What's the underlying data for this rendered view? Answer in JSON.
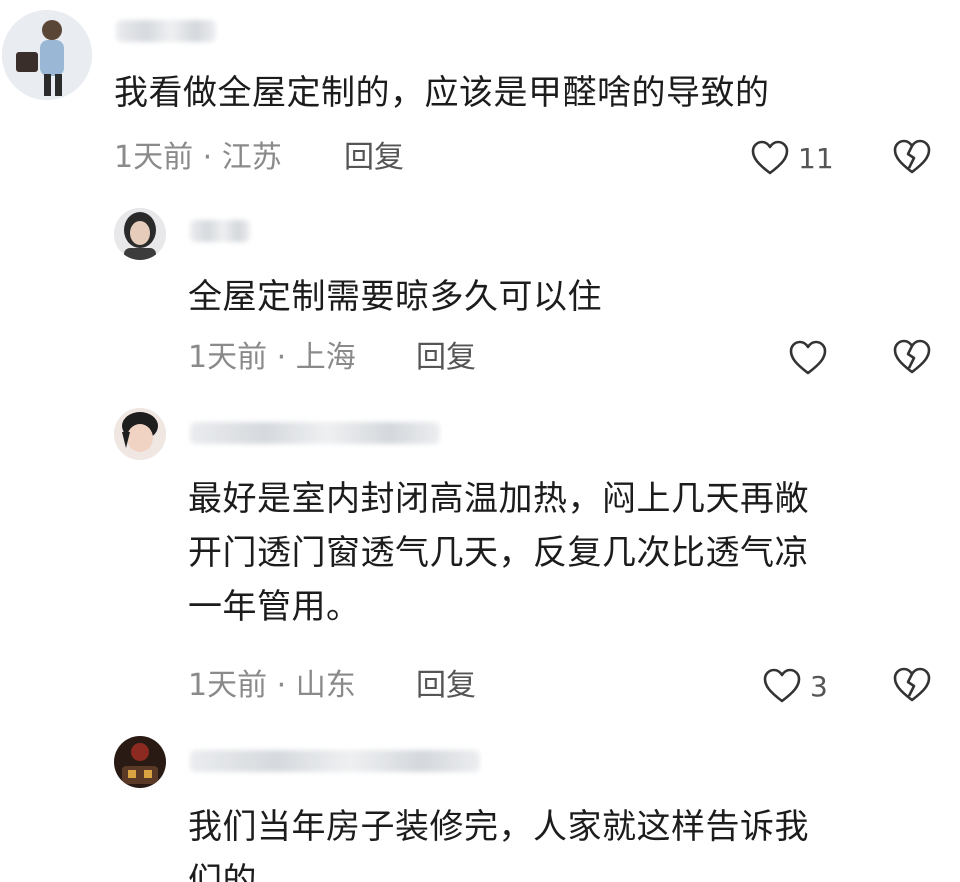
{
  "comments": [
    {
      "text": "我看做全屋定制的，应该是甲醛啥的导致的",
      "time": "1天前",
      "location": "江苏",
      "reply_label": "回复",
      "likes": "11"
    },
    {
      "text": "全屋定制需要晾多久可以住",
      "time": "1天前",
      "location": "上海",
      "reply_label": "回复",
      "likes": ""
    },
    {
      "text": "最好是室内封闭高温加热，闷上几天再敞\n开门透门窗透气几天，反复几次比透气凉\n一年管用。",
      "time": "1天前",
      "location": "山东",
      "reply_label": "回复",
      "likes": "3"
    },
    {
      "text": "我们当年房子装修完，人家就这样告诉我\n们的。",
      "time": "",
      "location": "",
      "reply_label": "",
      "likes": ""
    }
  ],
  "meta_separator": " · ",
  "icons": {
    "like": "heart-outline-icon",
    "dislike": "broken-heart-icon"
  },
  "colors": {
    "text": "#1c1c1c",
    "meta": "#8a8a8a",
    "icon": "#333333"
  }
}
